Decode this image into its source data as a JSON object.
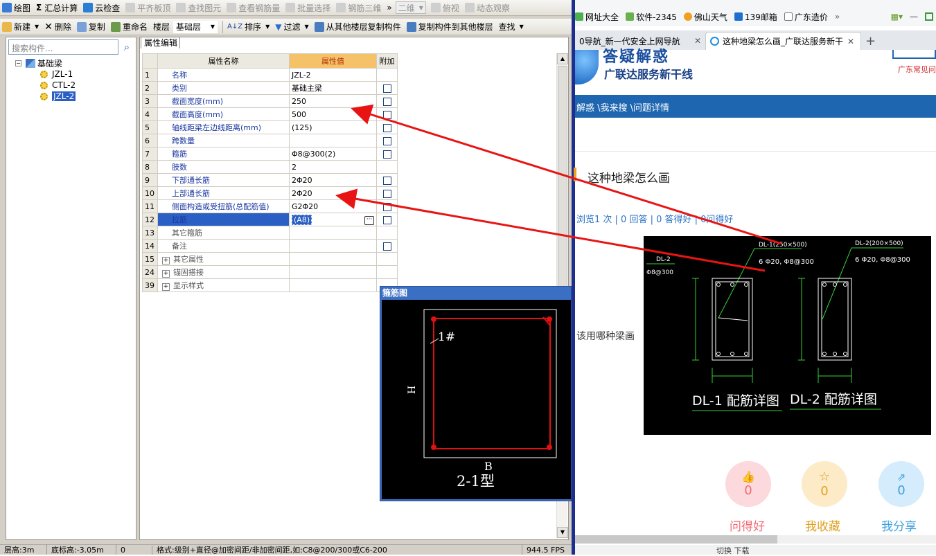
{
  "app": {
    "toolbar1": {
      "draw": "绘图",
      "sum": "汇总计算",
      "cloud_check": "云检查",
      "flat_slab": "平齐板顶",
      "find_element": "查找图元",
      "view_rebar": "查看钢筋量",
      "batch_select": "批量选择",
      "rebar_3d": "钢筋三维",
      "more": "»",
      "view_mode": "二维",
      "top_view": "俯视",
      "dynamic_view": "动态观察"
    },
    "toolbar2": {
      "new": "新建",
      "delete": "删除",
      "copy": "复制",
      "rename": "重命名",
      "floor_label": "楼层",
      "floor_value": "基础层",
      "sort": "排序",
      "filter": "过滤",
      "copy_from_other": "从其他楼层复制构件",
      "copy_to_other": "复制构件到其他楼层",
      "find": "查找"
    },
    "tree": {
      "search_placeholder": "搜索构件...",
      "root": "基础梁",
      "items": [
        "JZL-1",
        "CTL-2",
        "JZL-2"
      ]
    },
    "editor": {
      "tab": "属性编辑",
      "headers": {
        "name": "属性名称",
        "value": "属性值",
        "extra": "附加"
      },
      "rows": [
        {
          "no": "1",
          "name": "名称",
          "value": "JZL-2"
        },
        {
          "no": "2",
          "name": "类别",
          "value": "基础主梁"
        },
        {
          "no": "3",
          "name": "截面宽度(mm)",
          "value": "250"
        },
        {
          "no": "4",
          "name": "截面高度(mm)",
          "value": "500"
        },
        {
          "no": "5",
          "name": "轴线距梁左边线距离(mm)",
          "value": "(125)"
        },
        {
          "no": "6",
          "name": "跨数量",
          "value": ""
        },
        {
          "no": "7",
          "name": "箍筋",
          "value": "Φ8@300(2)"
        },
        {
          "no": "8",
          "name": "肢数",
          "value": "2"
        },
        {
          "no": "9",
          "name": "下部通长筋",
          "value": "2Φ20"
        },
        {
          "no": "10",
          "name": "上部通长筋",
          "value": "2Φ20"
        },
        {
          "no": "11",
          "name": "侧面构造或受扭筋(总配筋值)",
          "value": "G2Φ20"
        },
        {
          "no": "12",
          "name": "拉筋",
          "value": "(A8)"
        },
        {
          "no": "13",
          "name": "其它箍筋",
          "value": ""
        },
        {
          "no": "14",
          "name": "备注",
          "value": ""
        },
        {
          "no": "15",
          "name": "其它属性",
          "value": ""
        },
        {
          "no": "24",
          "name": "锚固搭接",
          "value": ""
        },
        {
          "no": "39",
          "name": "显示样式",
          "value": ""
        }
      ]
    },
    "stirrup_dialog": {
      "title": "箍筋图",
      "label_1": "1#",
      "label_h": "H",
      "label_b": "B",
      "type": "2-1型"
    },
    "status": {
      "floor_height": "层高:3m",
      "bottom_elev": "底标高:-3.05m",
      "zero": "0",
      "hint": "格式:级别+直径@加密间距/非加密间距,如:C8@200/300或C6-200",
      "fps": "944.5 FPS"
    }
  },
  "browser": {
    "bookmarks": [
      "网址大全",
      "软件-2345",
      "佛山天气",
      "139邮箱",
      "广东造价"
    ],
    "tabs": [
      {
        "label": "0导航_新一代安全上网导航"
      },
      {
        "label": "这种地梁怎么画_广联达服务新干"
      }
    ],
    "brand": "广联达服务新干线",
    "brand_big": "答疑解惑",
    "right_link": "广东常见问",
    "nav": "解惑 \\我来搜 \\问题详情",
    "question_title": "这种地梁怎么画",
    "stats": "浏览1 次 | 0 回答 | 0 答得好 | 0问得好",
    "question_body": "该用哪种梁画",
    "drawing": {
      "dl1_tag": "DL-1(250×500)",
      "dl2_tag": "DL-2(200×500)",
      "dl2_left": "DL-2",
      "dl2_left_sub": "Φ8@300",
      "rebar1": "6 Φ20, Φ8@300",
      "rebar2": "6 Φ20, Φ8@300",
      "caption1": "DL-1 配筋详图",
      "caption2": "DL-2 配筋详图"
    },
    "actions": [
      {
        "count": "0",
        "label": "问得好",
        "color": "#f06a74"
      },
      {
        "count": "0",
        "label": "我收藏",
        "color": "#e0a020"
      },
      {
        "count": "0",
        "label": "我分享",
        "color": "#3ca0e0"
      }
    ],
    "status_right": "切换 下载"
  }
}
